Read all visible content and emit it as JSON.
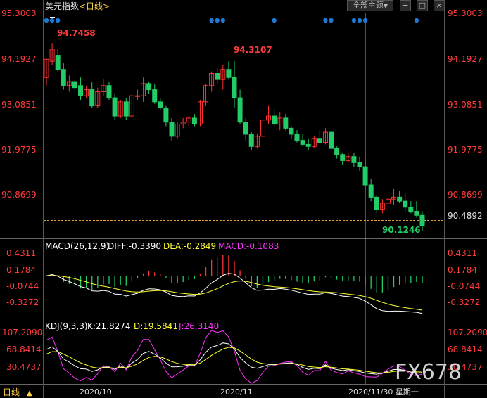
{
  "main": {
    "title": "美元指数",
    "period_tag": "<日线>",
    "y_ticks": [
      "95.3003",
      "94.1927",
      "93.0851",
      "91.9775",
      "90.8699"
    ],
    "current_price": "90.4892",
    "high_label": "94.7458",
    "mid_high_label": "94.3107",
    "low_label": "90.1246"
  },
  "toolbar": {
    "theme_label": "全部主题",
    "theme_arrow": "▼"
  },
  "macd": {
    "label": "MACD(26,12,9)",
    "diff": "DIFF:-0.3390",
    "dea": "DEA:-0.2849",
    "macd": "MACD:-0.1083",
    "y_ticks": [
      "0.4311",
      "0.1784",
      "-0.0744",
      "-0.3272"
    ]
  },
  "kdj": {
    "label": "KDJ(9,3,3)",
    "k": "K:21.8274",
    "d": "D:19.5841",
    "j": "J:26.3140",
    "y_ticks": [
      "107.2090",
      "68.8414",
      "30.4737"
    ]
  },
  "x_axis": {
    "period_label": "日线",
    "dates": [
      "2020/10",
      "2020/11"
    ],
    "cursor_label": "2020/11/30 星期一"
  },
  "watermark": "FX678",
  "colors": {
    "up": "#ff3333",
    "down": "#22cc66",
    "price_text": "#ff3c3c",
    "diff_line": "#ffffff",
    "dea_line": "#ffff33",
    "j_line": "#ff33ff",
    "marker": "#1f78d1",
    "period": "#ffd24a"
  },
  "chart_data": {
    "type": "candlestick",
    "title": "美元指数",
    "ylim": [
      89.95,
      95.5
    ],
    "candles": [
      [
        93.9,
        94.35,
        93.7,
        94.35
      ],
      [
        94.3,
        94.75,
        94.2,
        94.6
      ],
      [
        94.45,
        94.6,
        94.05,
        94.1
      ],
      [
        94.1,
        94.25,
        93.6,
        93.7
      ],
      [
        93.7,
        93.95,
        93.55,
        93.8
      ],
      [
        93.8,
        93.9,
        93.55,
        93.65
      ],
      [
        93.7,
        93.9,
        93.35,
        93.45
      ],
      [
        93.45,
        93.7,
        93.4,
        93.6
      ],
      [
        93.6,
        93.8,
        93.15,
        93.2
      ],
      [
        93.2,
        93.65,
        93.15,
        93.55
      ],
      [
        93.55,
        93.85,
        93.45,
        93.7
      ],
      [
        93.7,
        93.8,
        93.35,
        93.4
      ],
      [
        93.4,
        93.5,
        92.85,
        92.95
      ],
      [
        92.95,
        93.35,
        92.9,
        93.3
      ],
      [
        93.3,
        93.4,
        92.85,
        92.95
      ],
      [
        92.95,
        93.5,
        92.9,
        93.45
      ],
      [
        93.45,
        93.6,
        93.35,
        93.45
      ],
      [
        93.45,
        93.9,
        93.3,
        93.75
      ],
      [
        93.75,
        93.8,
        93.5,
        93.6
      ],
      [
        93.6,
        93.75,
        93.25,
        93.3
      ],
      [
        93.3,
        93.4,
        93.1,
        93.15
      ],
      [
        93.15,
        93.2,
        92.7,
        92.8
      ],
      [
        92.8,
        92.9,
        92.35,
        92.45
      ],
      [
        92.45,
        92.8,
        92.4,
        92.75
      ],
      [
        92.75,
        92.9,
        92.65,
        92.8
      ],
      [
        92.8,
        92.95,
        92.7,
        92.9
      ],
      [
        92.9,
        93.0,
        92.7,
        92.75
      ],
      [
        92.75,
        93.35,
        92.7,
        93.3
      ],
      [
        93.3,
        93.75,
        93.2,
        93.7
      ],
      [
        93.7,
        94.05,
        93.55,
        94.0
      ],
      [
        94.0,
        94.15,
        93.75,
        93.85
      ],
      [
        93.85,
        94.2,
        93.6,
        94.1
      ],
      [
        94.1,
        94.3,
        93.85,
        93.9
      ],
      [
        93.9,
        94.3,
        93.15,
        93.4
      ],
      [
        93.4,
        93.6,
        92.75,
        92.8
      ],
      [
        92.8,
        92.9,
        92.35,
        92.5
      ],
      [
        92.5,
        92.55,
        92.1,
        92.2
      ],
      [
        92.2,
        92.5,
        92.15,
        92.45
      ],
      [
        92.45,
        92.9,
        92.35,
        92.85
      ],
      [
        92.85,
        93.2,
        92.75,
        92.95
      ],
      [
        92.95,
        93.15,
        92.7,
        92.75
      ],
      [
        92.75,
        93.05,
        92.6,
        92.9
      ],
      [
        92.9,
        93.0,
        92.6,
        92.65
      ],
      [
        92.65,
        92.7,
        92.4,
        92.5
      ],
      [
        92.5,
        92.6,
        92.3,
        92.35
      ],
      [
        92.35,
        92.5,
        92.2,
        92.25
      ],
      [
        92.25,
        92.4,
        92.1,
        92.2
      ],
      [
        92.2,
        92.45,
        92.15,
        92.4
      ],
      [
        92.4,
        92.6,
        92.25,
        92.3
      ],
      [
        92.3,
        92.65,
        92.25,
        92.55
      ],
      [
        92.55,
        92.6,
        92.1,
        92.15
      ],
      [
        92.15,
        92.2,
        91.9,
        92.0
      ],
      [
        92.0,
        92.05,
        91.75,
        91.85
      ],
      [
        91.85,
        92.05,
        91.8,
        91.95
      ],
      [
        91.95,
        92.05,
        91.7,
        91.8
      ],
      [
        91.8,
        91.95,
        91.6,
        91.7
      ],
      [
        91.7,
        91.9,
        91.2,
        91.25
      ],
      [
        91.25,
        91.4,
        90.85,
        90.95
      ],
      [
        90.95,
        91.0,
        90.55,
        90.65
      ],
      [
        90.65,
        90.9,
        90.55,
        90.8
      ],
      [
        90.8,
        91.0,
        90.7,
        90.9
      ],
      [
        90.9,
        91.15,
        90.75,
        90.95
      ],
      [
        90.95,
        91.1,
        90.8,
        90.85
      ],
      [
        90.85,
        91.05,
        90.6,
        90.7
      ],
      [
        90.7,
        90.85,
        90.55,
        90.6
      ],
      [
        90.6,
        90.85,
        90.45,
        90.5
      ],
      [
        90.5,
        90.6,
        90.12,
        90.25
      ]
    ],
    "cursor_index": 56
  }
}
